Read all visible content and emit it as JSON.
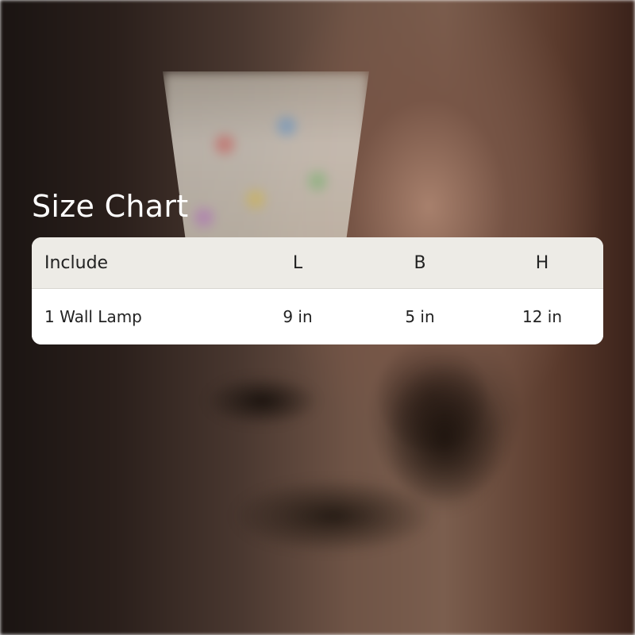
{
  "title": "Size Chart",
  "table": {
    "headers": [
      "Include",
      "L",
      "B",
      "H"
    ],
    "rows": [
      [
        "1 Wall Lamp",
        "9 in",
        "5 in",
        "12 in"
      ]
    ]
  }
}
